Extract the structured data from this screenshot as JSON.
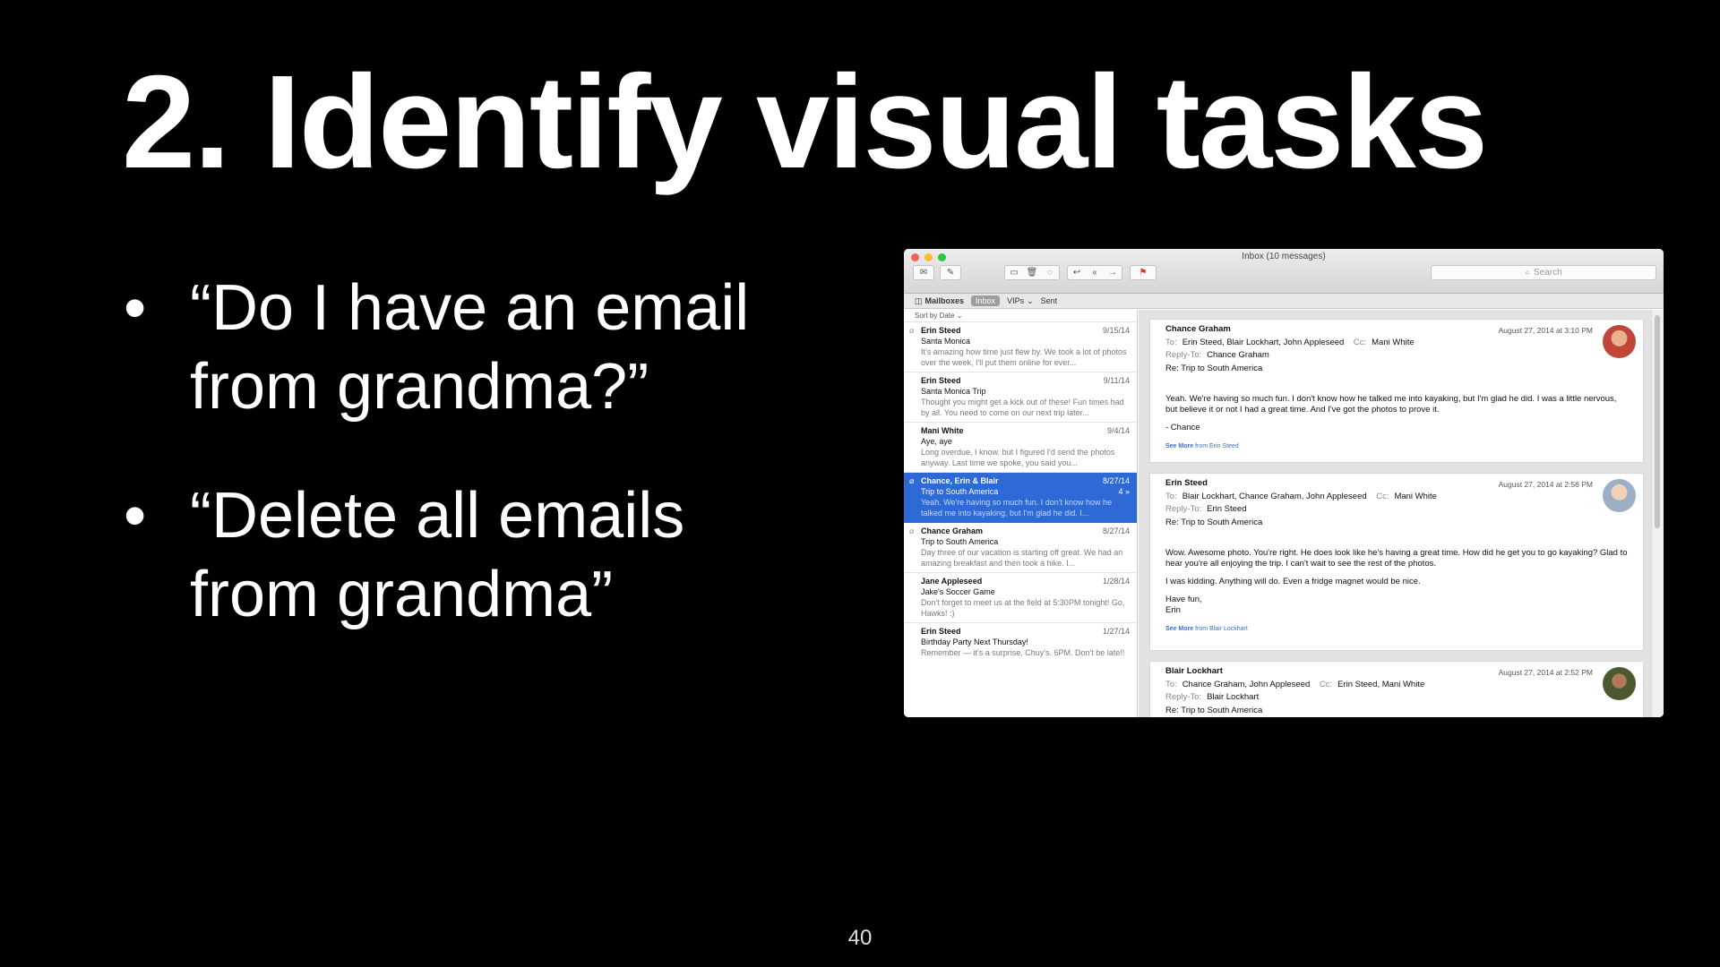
{
  "slide": {
    "title": "2. Identify visual tasks",
    "bullets": [
      {
        "line1": "“Do I have an email",
        "line2": "from grandma?”"
      },
      {
        "line1": "“Delete all emails",
        "line2": "from grandma”"
      }
    ],
    "page_number": "40"
  },
  "mail": {
    "window_title": "Inbox (10 messages)",
    "search_placeholder": "Search",
    "favorites": {
      "mailboxes": "Mailboxes",
      "inbox": "Inbox",
      "vips": "VIPs",
      "sent": "Sent"
    },
    "sort_label": "Sort by Date",
    "messages": [
      {
        "sender": "Erin Steed",
        "date": "9/15/14",
        "subject": "Santa Monica",
        "preview": "It's amazing how time just flew by. We took a lot of photos over the week, I'll put them online for ever..."
      },
      {
        "sender": "Erin Steed",
        "date": "9/11/14",
        "subject": "Santa Monica Trip",
        "preview": "Thought you might get a kick out of these! Fun times had by all. You need to come on our next trip later..."
      },
      {
        "sender": "Mani White",
        "date": "9/4/14",
        "subject": "Aye, aye",
        "preview": "Long overdue, I know. but I figured I'd send the photos anyway. Last time we spoke, you said you..."
      },
      {
        "sender": "Chance, Erin & Blair",
        "date": "8/27/14",
        "subject": "Trip to South America",
        "count": "4 »",
        "preview": "Yeah. We're having so much fun. I don't know how he talked me into kayaking, but I'm glad he did. I..."
      },
      {
        "sender": "Chance Graham",
        "date": "8/27/14",
        "subject": "Trip to South America",
        "preview": "Day three of our vacation is starting off great. We had an amazing breakfast and then took a hike. I..."
      },
      {
        "sender": "Jane Appleseed",
        "date": "1/28/14",
        "subject": "Jake's Soccer Game",
        "preview": "Don't forget to meet us at the field at 5:30PM tonight! Go, Hawks! :)"
      },
      {
        "sender": "Erin Steed",
        "date": "1/27/14",
        "subject": "Birthday Party Next Thursday!",
        "preview": "Remember — it's a surprise. Chuy's. 6PM. Don't be late!!"
      }
    ],
    "thread": [
      {
        "from": "Chance Graham",
        "date": "August 27, 2014 at 3:10 PM",
        "to_label": "To:",
        "to": "Erin Steed,    Blair Lockhart,    John Appleseed",
        "cc_label": "Cc:",
        "cc": "Mani White",
        "reply_label": "Reply-To:",
        "reply_to": "Chance Graham",
        "subject": "Re: Trip to South America",
        "body": [
          "Yeah. We're having so much fun. I don't know how he talked me into kayaking, but I'm glad he did. I was a little nervous, but believe it or not I had a great time. And I've got the photos to prove it.",
          "- Chance"
        ],
        "see_more": "See More",
        "see_more_from": "from Erin Steed",
        "avatar_color": "#c0463a"
      },
      {
        "from": "Erin Steed",
        "date": "August 27, 2014 at 2:56 PM",
        "to_label": "To:",
        "to": "Blair Lockhart,    Chance Graham,    John Appleseed",
        "cc_label": "Cc:",
        "cc": "Mani White",
        "reply_label": "Reply-To:",
        "reply_to": "Erin Steed",
        "subject": "Re: Trip to South America",
        "body": [
          "Wow. Awesome photo. You're right. He does look like he's having a great time. How did he get you to go kayaking? Glad to hear you're all enjoying the trip. I can't wait to see the rest of the photos.",
          "I was kidding. Anything will do. Even a fridge magnet would be nice.",
          "Have fun,\nErin"
        ],
        "see_more": "See More",
        "see_more_from": "from Blair Lockhart",
        "avatar_color": "#9bb0c4"
      },
      {
        "from": "Blair Lockhart",
        "date": "August 27, 2014 at 2:52 PM",
        "to_label": "To:",
        "to": "Chance Graham,    John Appleseed",
        "cc_label": "Cc:",
        "cc": "Erin Steed,    Mani White",
        "reply_label": "Reply-To:",
        "reply_to": "Blair Lockhart",
        "subject": "Re: Trip to South America",
        "avatar_color": "#4a5a2e"
      }
    ]
  }
}
